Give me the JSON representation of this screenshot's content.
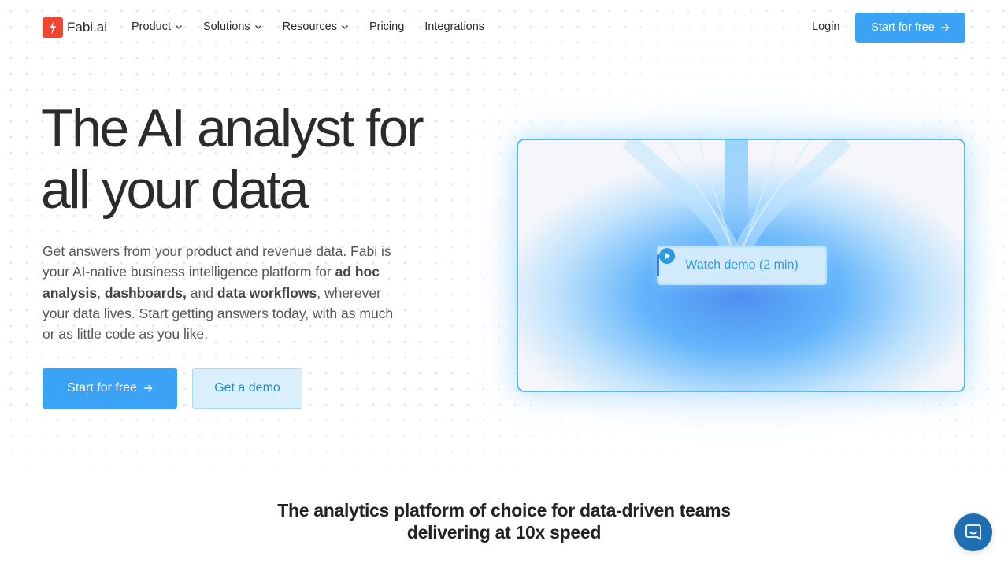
{
  "brand": {
    "name": "Fabi.ai",
    "accent": "#3aa3f5",
    "logo_color": "#f0462f"
  },
  "nav": {
    "items": [
      {
        "label": "Product",
        "has_dropdown": true
      },
      {
        "label": "Solutions",
        "has_dropdown": true
      },
      {
        "label": "Resources",
        "has_dropdown": true
      },
      {
        "label": "Pricing",
        "has_dropdown": false
      },
      {
        "label": "Integrations",
        "has_dropdown": false
      }
    ],
    "login": "Login",
    "cta": "Start for free"
  },
  "hero": {
    "title_line1": "The AI analyst for",
    "title_line2": "all your data",
    "desc_part1": "Get answers from your product and revenue data. Fabi is your AI-native business intelligence platform for ",
    "bold1": "ad hoc analysis",
    "desc_part2": ", ",
    "bold2": "dashboards,",
    "desc_part3": " and ",
    "bold3": "data workflows",
    "desc_part4": ", wherever your data lives. Start getting answers today, with as much or as little code as you like.",
    "primary_cta": "Start for free",
    "secondary_cta": "Get a demo"
  },
  "video": {
    "label": "Watch demo (2 min)",
    "icon": "play-circle-icon"
  },
  "tagline": {
    "line1": "The analytics platform of choice for data-driven teams",
    "line2": "delivering at 10x speed"
  },
  "chat": {
    "icon": "chat-bubble-icon"
  }
}
